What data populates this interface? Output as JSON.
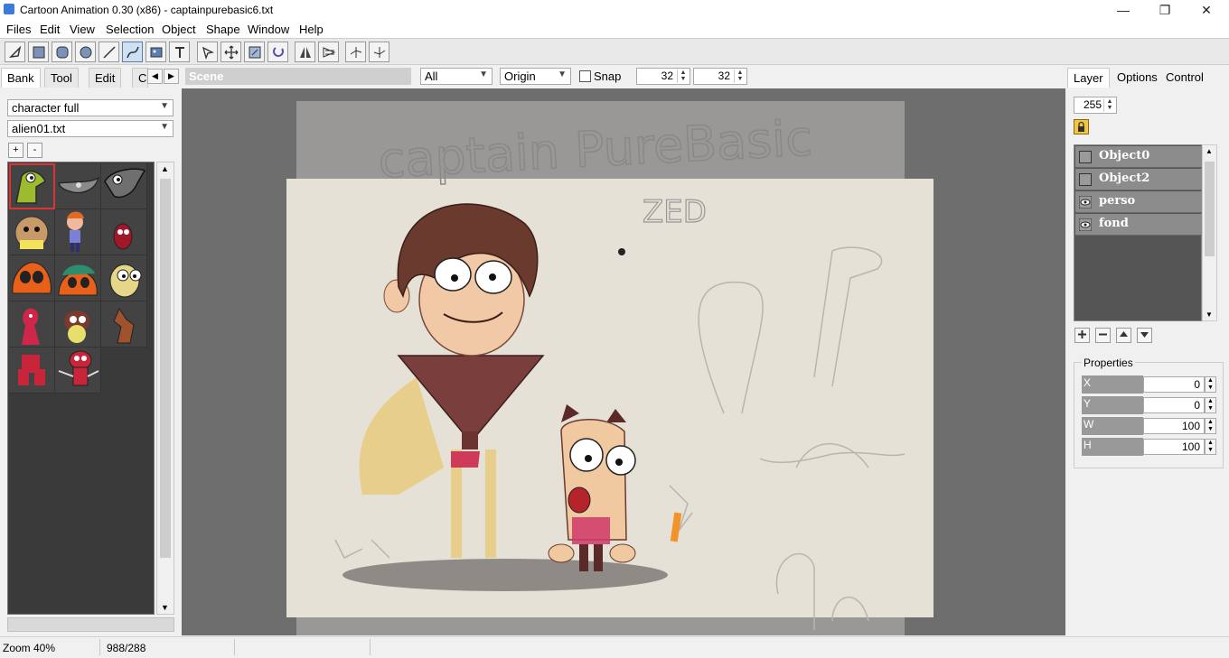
{
  "window": {
    "title": "Cartoon Animation 0.30 (x86) - captainpurebasic6.txt",
    "minimize": "—",
    "maximize": "❐",
    "close": "✕"
  },
  "menu": [
    "Files",
    "Edit",
    "View",
    "Selection",
    "Object",
    "Shape",
    "Window",
    "Help"
  ],
  "toolbar": {
    "tools": [
      "select-tool",
      "rectangle-tool",
      "rounded-rect-tool",
      "ellipse-tool",
      "line-tool",
      "curve-tool",
      "image-tool",
      "text-tool",
      "node-edit-tool",
      "move-tool",
      "scale-tool",
      "rotate-tool",
      "flip-horizontal-tool",
      "flip-vertical-tool",
      "align-left-tool",
      "align-right-tool"
    ],
    "active_tool": "curve-tool"
  },
  "left_panel": {
    "tabs": [
      "Bank",
      "Tool",
      "Edit",
      "Cc"
    ],
    "selected_tab": "Bank",
    "category": "character full",
    "file": "alien01.txt",
    "add_label": "+",
    "remove_label": "-",
    "selected_thumb": 0
  },
  "scene": {
    "label": "Scene",
    "filter": "All",
    "anchor": "Origin",
    "snap_label": "Snap",
    "grid_x": "32",
    "grid_y": "32"
  },
  "canvas": {
    "sketch_title": "captain PureBasic",
    "sketch_note": "ZED"
  },
  "right_panel": {
    "tabs": [
      "Layer",
      "Options",
      "Control"
    ],
    "selected_tab": "Layer",
    "alpha": "255",
    "layers": [
      {
        "name": "Object0",
        "visible": false
      },
      {
        "name": "Object2",
        "visible": false
      },
      {
        "name": "perso",
        "visible": true
      },
      {
        "name": "fond",
        "visible": true
      }
    ],
    "properties_title": "Properties",
    "properties": [
      {
        "label": "X",
        "value": "0"
      },
      {
        "label": "Y",
        "value": "0"
      },
      {
        "label": "W",
        "value": "100"
      },
      {
        "label": "H",
        "value": "100"
      }
    ]
  },
  "status": {
    "zoom": "Zoom 40%",
    "coords": "988/288"
  },
  "colors": {
    "canvas_bg": "#6e6e6e",
    "paper": "#e6e1d6",
    "skin": "#f2c9a6",
    "hair": "#6b3a2e",
    "shirt": "#7a3f3c",
    "accent": "#d03a5a"
  }
}
